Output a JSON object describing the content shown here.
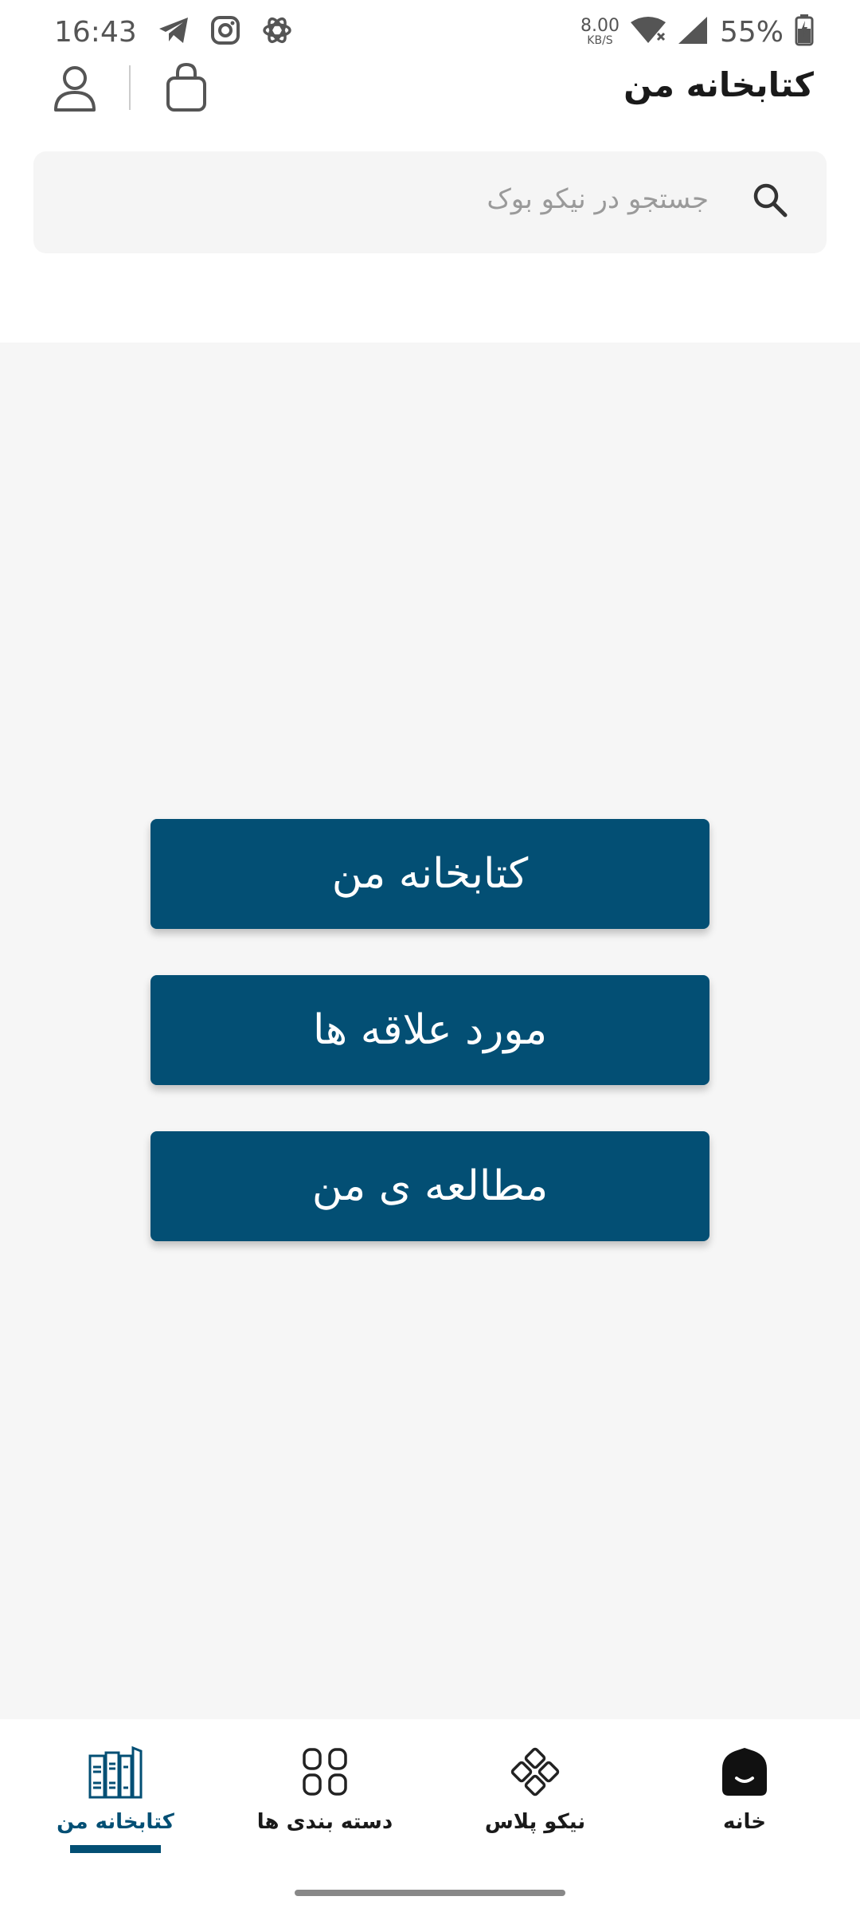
{
  "status_bar": {
    "time": "16:43",
    "net_speed_value": "8.00",
    "net_speed_unit": "KB/S",
    "battery": "55%",
    "icons": [
      "telegram-icon",
      "instagram-icon",
      "openai-icon",
      "wifi-icon",
      "signal-icon",
      "battery-icon"
    ]
  },
  "app_bar": {
    "title": "کتابخانه من",
    "icons": [
      "user-icon",
      "shopping-bag-icon"
    ]
  },
  "search": {
    "placeholder": "جستجو در نیکو بوک",
    "icon": "search-icon"
  },
  "main": {
    "buttons": [
      {
        "label": "کتابخانه من"
      },
      {
        "label": "مورد علاقه ها"
      },
      {
        "label": "مطالعه ی من"
      }
    ]
  },
  "bottom_nav": {
    "items": [
      {
        "label": "کتابخانه من",
        "icon": "books-icon",
        "active": true
      },
      {
        "label": "دسته بندی ها",
        "icon": "categories-icon",
        "active": false
      },
      {
        "label": "نیکو پلاس",
        "icon": "niko-plus-icon",
        "active": false
      },
      {
        "label": "خانه",
        "icon": "home-icon",
        "active": false
      }
    ]
  },
  "colors": {
    "primary": "#034f74",
    "background": "#f6f6f6",
    "search_bg": "#f5f5f5",
    "text": "#1a1a1a"
  }
}
